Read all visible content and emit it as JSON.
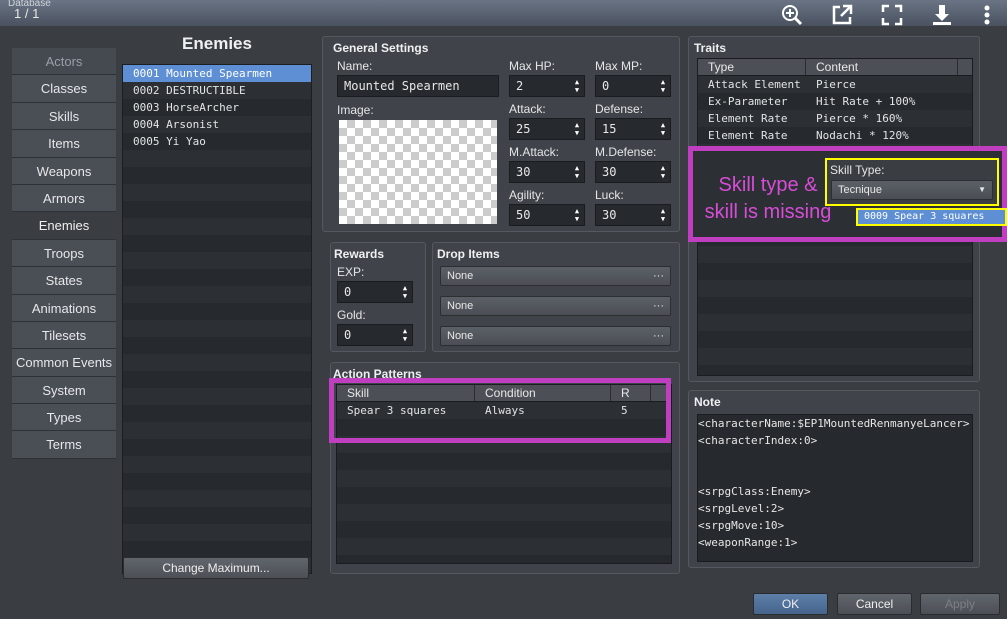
{
  "window": {
    "title": "Database",
    "pager": "1 / 1"
  },
  "viewer_icons": [
    "zoom-in-icon",
    "open-external-icon",
    "fullscreen-icon",
    "download-icon"
  ],
  "tabs": [
    "Actors",
    "Classes",
    "Skills",
    "Items",
    "Weapons",
    "Armors",
    "Enemies",
    "Troops",
    "States",
    "Animations",
    "Tilesets",
    "Common Events",
    "System",
    "Types",
    "Terms"
  ],
  "active_tab": "Enemies",
  "list": {
    "title": "Enemies",
    "items": [
      "0001 Mounted Spearmen",
      "0002 DESTRUCTIBLE",
      "0003 HorseArcher",
      "0004 Arsonist",
      "0005 Yi Yao"
    ],
    "selected": 0,
    "change_max": "Change Maximum..."
  },
  "general": {
    "title": "General Settings",
    "name_label": "Name:",
    "name": "Mounted Spearmen",
    "image_label": "Image:",
    "maxhp_label": "Max HP:",
    "maxhp": "2",
    "maxmp_label": "Max MP:",
    "maxmp": "0",
    "attack_label": "Attack:",
    "attack": "25",
    "defense_label": "Defense:",
    "defense": "15",
    "matk_label": "M.Attack:",
    "matk": "30",
    "mdef_label": "M.Defense:",
    "mdef": "30",
    "agi_label": "Agility:",
    "agi": "50",
    "luck_label": "Luck:",
    "luck": "30"
  },
  "rewards": {
    "title": "Rewards",
    "exp_label": "EXP:",
    "exp": "0",
    "gold_label": "Gold:",
    "gold": "0"
  },
  "drops": {
    "title": "Drop Items",
    "items": [
      "None",
      "None",
      "None"
    ],
    "more": "···"
  },
  "actions": {
    "title": "Action Patterns",
    "headers": [
      "Skill",
      "Condition",
      "R"
    ],
    "rows": [
      [
        "Spear 3 squares",
        "Always",
        "5"
      ]
    ]
  },
  "traits": {
    "title": "Traits",
    "headers": [
      "Type",
      "Content"
    ],
    "rows": [
      [
        "Attack Element",
        "Pierce"
      ],
      [
        "Ex-Parameter",
        "Hit Rate + 100%"
      ],
      [
        "Element Rate",
        "Pierce * 160%"
      ],
      [
        "Element Rate",
        "Nodachi * 120%"
      ]
    ]
  },
  "annotation": {
    "text_line1": "Skill type &",
    "text_line2": "skill is missing",
    "skill_type_label": "Skill Type:",
    "skill_type_value": "Tecnique",
    "skill_value": "0009 Spear 3 squares",
    "color": "#c03ec0",
    "highlight_color": "#ffff00"
  },
  "note": {
    "title": "Note",
    "text": "<characterName:$EP1MountedRenmanyeLancer>\n<characterIndex:0>\n\n\n<srpgClass:Enemy>\n<srpgLevel:2>\n<srpgMove:10>\n<weaponRange:1>"
  },
  "buttons": {
    "ok": "OK",
    "cancel": "Cancel",
    "apply": "Apply"
  }
}
